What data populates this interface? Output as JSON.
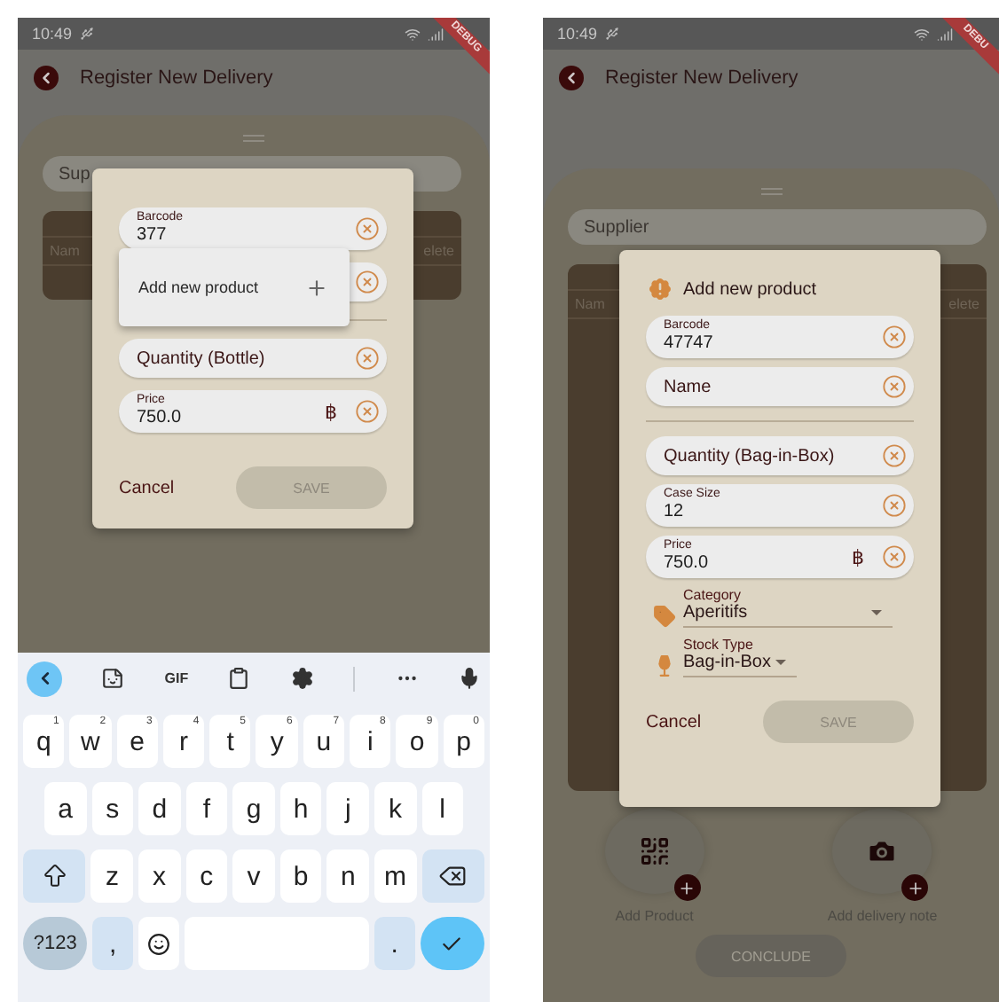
{
  "left_screen": {
    "status_bar": {
      "time": "10:49"
    },
    "debug_banner": "DEBUG",
    "app_bar": {
      "title": "Register New Delivery"
    },
    "background": {
      "supplier_field": {
        "placeholder": "Sup"
      },
      "table_columns": [
        "Nam",
        "elete"
      ]
    },
    "dialog": {
      "fields": [
        {
          "kind": "text",
          "label": "Barcode",
          "value": "377"
        },
        {
          "kind": "text"
        },
        {
          "kind": "divider"
        },
        {
          "kind": "text",
          "placeholder": "Quantity (Bottle)"
        },
        {
          "kind": "text",
          "label": "Price",
          "value": "750.0",
          "suffix": "฿"
        }
      ],
      "suggestion": {
        "label": "Add new product"
      },
      "cancel": "Cancel",
      "save": {
        "label": "SAVE",
        "disabled": true
      }
    },
    "keyboard": {
      "toolbar_text": "GIF",
      "key_rows": [
        {
          "keys": [
            {
              "kind": "letter",
              "label": "q",
              "hint": "1"
            },
            {
              "kind": "letter",
              "label": "w",
              "hint": "2"
            },
            {
              "kind": "letter",
              "label": "e",
              "hint": "3"
            },
            {
              "kind": "letter",
              "label": "r",
              "hint": "4"
            },
            {
              "kind": "letter",
              "label": "t",
              "hint": "5"
            },
            {
              "kind": "letter",
              "label": "y",
              "hint": "6"
            },
            {
              "kind": "letter",
              "label": "u",
              "hint": "7"
            },
            {
              "kind": "letter",
              "label": "i",
              "hint": "8"
            },
            {
              "kind": "letter",
              "label": "o",
              "hint": "9"
            },
            {
              "kind": "letter",
              "label": "p",
              "hint": "0"
            }
          ]
        },
        {
          "keys": [
            {
              "kind": "letter",
              "label": "a"
            },
            {
              "kind": "letter",
              "label": "s"
            },
            {
              "kind": "letter",
              "label": "d"
            },
            {
              "kind": "letter",
              "label": "f"
            },
            {
              "kind": "letter",
              "label": "g"
            },
            {
              "kind": "letter",
              "label": "h"
            },
            {
              "kind": "letter",
              "label": "j"
            },
            {
              "kind": "letter",
              "label": "k"
            },
            {
              "kind": "letter",
              "label": "l"
            }
          ]
        },
        {
          "keys": [
            {
              "kind": "shift"
            },
            {
              "kind": "letter",
              "label": "z"
            },
            {
              "kind": "letter",
              "label": "x"
            },
            {
              "kind": "letter",
              "label": "c"
            },
            {
              "kind": "letter",
              "label": "v"
            },
            {
              "kind": "letter",
              "label": "b"
            },
            {
              "kind": "letter",
              "label": "n"
            },
            {
              "kind": "letter",
              "label": "m"
            },
            {
              "kind": "backspace"
            }
          ]
        },
        {
          "keys": [
            {
              "kind": "symbols",
              "label": "?123"
            },
            {
              "kind": "punct",
              "label": ","
            },
            {
              "kind": "emoji"
            },
            {
              "kind": "space"
            },
            {
              "kind": "punct",
              "label": "."
            },
            {
              "kind": "enter"
            }
          ]
        }
      ]
    }
  },
  "right_screen": {
    "status_bar": {
      "time": "10:49"
    },
    "debug_banner": "DEBU",
    "app_bar": {
      "title": "Register New Delivery"
    },
    "background": {
      "supplier_field": {
        "placeholder": "Supplier"
      },
      "table_columns": [
        "Nam",
        "elete"
      ]
    },
    "dialog": {
      "title": "Add new product",
      "fields": [
        {
          "kind": "text",
          "label": "Barcode",
          "value": "47747"
        },
        {
          "kind": "text",
          "placeholder": "Name"
        },
        {
          "kind": "divider"
        },
        {
          "kind": "text",
          "placeholder": "Quantity (Bag-in-Box)"
        },
        {
          "kind": "text",
          "label": "Case Size",
          "value": "12"
        },
        {
          "kind": "text",
          "label": "Price",
          "value": "750.0",
          "suffix": "฿"
        },
        {
          "kind": "category_dropdown",
          "label": "Category",
          "value": "Aperitifs"
        },
        {
          "kind": "stock_dropdown",
          "label": "Stock Type",
          "value": "Bag-in-Box"
        }
      ],
      "cancel": "Cancel",
      "save": {
        "label": "SAVE",
        "disabled": true
      }
    },
    "actions": [
      {
        "kind": "qr",
        "label": "Add Product"
      },
      {
        "kind": "camera",
        "label": "Add delivery note"
      }
    ],
    "conclude": {
      "label": "CONCLUDE",
      "disabled": true
    }
  }
}
